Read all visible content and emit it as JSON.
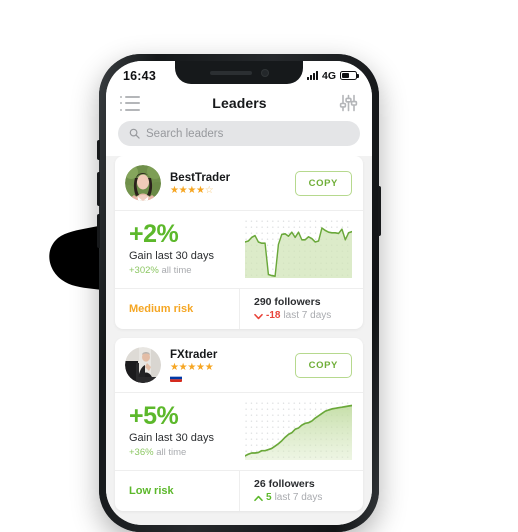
{
  "status_bar": {
    "time": "16:43",
    "network": "4G",
    "signal_icon": "signal-bars-icon",
    "battery_icon": "battery-icon"
  },
  "header": {
    "title": "Leaders",
    "menu_icon": "list-menu-icon",
    "filter_icon": "sliders-filter-icon"
  },
  "search": {
    "placeholder": "Search leaders",
    "value": "",
    "icon": "search-icon"
  },
  "colors": {
    "green": "#5cb82b",
    "green_light": "#8cc763",
    "green_border": "#b6d98e",
    "orange": "#f5a623",
    "star": "#f6a623",
    "red": "#e8443a",
    "screen_bg": "#f2f2f2",
    "card_bg": "#ffffff",
    "frame": "#1d2022"
  },
  "leaders": [
    {
      "name": "BestTrader",
      "rating": 4,
      "rating_max": 5,
      "flag": null,
      "copy_label": "COPY",
      "gain_value": "+2%",
      "gain_label": "Gain last 30 days",
      "all_time_amount": "+302%",
      "all_time_suffix": "all time",
      "risk": "Medium risk",
      "risk_level": "medium",
      "followers": "290 followers",
      "delta_amount": "-18",
      "delta_suffix": "last 7 days",
      "delta_direction": "down",
      "chart_data": {
        "type": "area",
        "title": "BestTrader gain last 30 days",
        "grid": "dotted",
        "ylim": [
          0,
          100
        ],
        "values": [
          62,
          64,
          70,
          73,
          62,
          60,
          60,
          8,
          6,
          5,
          58,
          75,
          76,
          72,
          79,
          70,
          79,
          66,
          66,
          71,
          68,
          62,
          64,
          86,
          82,
          79,
          78,
          78,
          77,
          84,
          66,
          78,
          80
        ]
      }
    },
    {
      "name": "FXtrader",
      "rating": 5,
      "rating_max": 5,
      "flag": "russia-flag-icon",
      "copy_label": "COPY",
      "gain_value": "+5%",
      "gain_label": "Gain last 30 days",
      "all_time_amount": "+36%",
      "all_time_suffix": "all time",
      "risk": "Low risk",
      "risk_level": "low",
      "followers": "26 followers",
      "delta_amount": "5",
      "delta_suffix": "last 7 days",
      "delta_direction": "up",
      "chart_data": {
        "type": "area",
        "title": "FXtrader gain last 30 days",
        "grid": "dotted",
        "ylim": [
          0,
          100
        ],
        "values": [
          7,
          10,
          12,
          12,
          13,
          16,
          16,
          18,
          20,
          24,
          28,
          33,
          39,
          44,
          47,
          53,
          55,
          60,
          63,
          64,
          67,
          72,
          76,
          80,
          84,
          86,
          88,
          89,
          90,
          91,
          92,
          93,
          94
        ]
      }
    }
  ]
}
